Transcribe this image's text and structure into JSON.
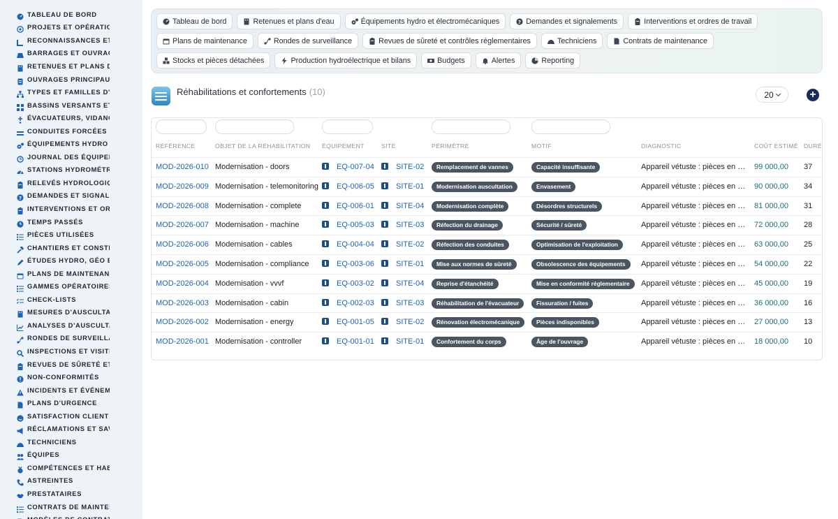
{
  "sidebar": {
    "items": [
      {
        "label": "Tableau de bord",
        "icon": "dashboard-icon"
      },
      {
        "label": "Projets et opérations",
        "icon": "target-icon"
      },
      {
        "label": "Reconnaissances et visites",
        "icon": "ruler-icon"
      },
      {
        "label": "Barrages et ouvrages",
        "icon": "dam-icon"
      },
      {
        "label": "Retenues et plans d'eau",
        "icon": "building-icon"
      },
      {
        "label": "Ouvrages principaux",
        "icon": "document-icon"
      },
      {
        "label": "Types et familles d'ouvrages",
        "icon": "sitemap-icon"
      },
      {
        "label": "Bassins versants et affluents",
        "icon": "grid-icon"
      },
      {
        "label": "Évacuateurs, vidanges",
        "icon": "faucet-icon"
      },
      {
        "label": "Conduites forcées et galeries",
        "icon": "pipe-icon"
      },
      {
        "label": "Équipements hydro et électromécaniques",
        "icon": "cogs-icon"
      },
      {
        "label": "Journal des équipements",
        "icon": "history-icon"
      },
      {
        "label": "Stations hydrométriques",
        "icon": "gauge-icon"
      },
      {
        "label": "Relevés hydrologiques",
        "icon": "clipboard-icon"
      },
      {
        "label": "Demandes et signalements",
        "icon": "question-icon"
      },
      {
        "label": "Interventions et ordres de travail",
        "icon": "clipboard-icon"
      },
      {
        "label": "Temps passés",
        "icon": "clock-icon"
      },
      {
        "label": "Pièces utilisées",
        "icon": "list-icon"
      },
      {
        "label": "Chantiers et constructions",
        "icon": "hammer-icon"
      },
      {
        "label": "Études hydro, géo et structure",
        "icon": "pencil-icon"
      },
      {
        "label": "Plans de maintenance",
        "icon": "calendar-icon"
      },
      {
        "label": "Gammes opératoires",
        "icon": "list-icon"
      },
      {
        "label": "Check-lists",
        "icon": "checklist-icon"
      },
      {
        "label": "Mesures d'auscultation",
        "icon": "building-icon"
      },
      {
        "label": "Analyses d'auscultation",
        "icon": "chart-icon"
      },
      {
        "label": "Rondes de surveillance",
        "icon": "route-icon"
      },
      {
        "label": "Inspections et visites",
        "icon": "search-icon"
      },
      {
        "label": "Revues de sûreté et contrôles",
        "icon": "clipboard-icon"
      },
      {
        "label": "Non-conformités",
        "icon": "alert-icon"
      },
      {
        "label": "Incidents et événements",
        "icon": "warning-icon"
      },
      {
        "label": "Plans d'urgence",
        "icon": "file-icon"
      },
      {
        "label": "Satisfaction client",
        "icon": "smile-icon"
      },
      {
        "label": "Réclamations et SAV",
        "icon": "megaphone-icon"
      },
      {
        "label": "Techniciens",
        "icon": "helmet-icon"
      },
      {
        "label": "Équipes",
        "icon": "users-icon"
      },
      {
        "label": "Compétences et habilitations",
        "icon": "medal-icon"
      },
      {
        "label": "Astreintes",
        "icon": "phone-icon"
      },
      {
        "label": "Prestataires",
        "icon": "handshake-icon"
      },
      {
        "label": "Contrats de maintenance",
        "icon": "list-icon"
      },
      {
        "label": "Modèles de contrats",
        "icon": "file-icon"
      }
    ]
  },
  "tabs": [
    {
      "label": "Tableau de bord",
      "icon": "dashboard-icon"
    },
    {
      "label": "Retenues et plans d'eau",
      "icon": "building-icon"
    },
    {
      "label": "Équipements hydro et électromécaniques",
      "icon": "cogs-icon"
    },
    {
      "label": "Demandes et signalements",
      "icon": "question-icon"
    },
    {
      "label": "Interventions et ordres de travail",
      "icon": "clipboard-icon"
    },
    {
      "label": "Plans de maintenance",
      "icon": "calendar-icon"
    },
    {
      "label": "Rondes de surveillance",
      "icon": "route-icon"
    },
    {
      "label": "Revues de sûreté et contrôles réglementaires",
      "icon": "clipboard-icon"
    },
    {
      "label": "Techniciens",
      "icon": "helmet-icon"
    },
    {
      "label": "Contrats de maintenance",
      "icon": "file-icon"
    },
    {
      "label": "Stocks et pièces détachées",
      "icon": "boxes-icon"
    },
    {
      "label": "Production hydroélectrique et bilans",
      "icon": "bolt-icon"
    },
    {
      "label": "Budgets",
      "icon": "money-icon"
    },
    {
      "label": "Alertes",
      "icon": "bell-icon"
    },
    {
      "label": "Reporting",
      "icon": "pie-icon"
    }
  ],
  "page": {
    "title": "Réhabilitations et confortements",
    "count": "(10)",
    "per_page": "20"
  },
  "columns": [
    "Référence",
    "Objet de la réhabilitation",
    "Équipement",
    "Site",
    "Périmètre",
    "Motif",
    "Diagnostic",
    "Coût estimé",
    "Durée"
  ],
  "rows": [
    {
      "ref": "MOD-2026-010",
      "objet": "Modernisation - doors",
      "equip": "EQ-007-04",
      "site": "SITE-02",
      "perimetre": "Remplacement de vannes",
      "motif": "Capacité insuffisante",
      "diag": "Appareil vétuste : pièces en obsolescence",
      "cout": "99 000,00",
      "duree": "37"
    },
    {
      "ref": "MOD-2026-009",
      "objet": "Modernisation - telemonitoring",
      "equip": "EQ-006-05",
      "site": "SITE-01",
      "perimetre": "Modernisation auscultation",
      "motif": "Envasement",
      "diag": "Appareil vétuste : pièces en obsolescence",
      "cout": "90 000,00",
      "duree": "34"
    },
    {
      "ref": "MOD-2026-008",
      "objet": "Modernisation - complete",
      "equip": "EQ-006-01",
      "site": "SITE-04",
      "perimetre": "Modernisation complète",
      "motif": "Désordres structurels",
      "diag": "Appareil vétuste : pièces en obsolescence",
      "cout": "81 000,00",
      "duree": "31"
    },
    {
      "ref": "MOD-2026-007",
      "objet": "Modernisation - machine",
      "equip": "EQ-005-03",
      "site": "SITE-03",
      "perimetre": "Réfection du drainage",
      "motif": "Sécurité / sûreté",
      "diag": "Appareil vétuste : pièces en obsolescence",
      "cout": "72 000,00",
      "duree": "28"
    },
    {
      "ref": "MOD-2026-006",
      "objet": "Modernisation - cables",
      "equip": "EQ-004-04",
      "site": "SITE-02",
      "perimetre": "Réfection des conduites",
      "motif": "Optimisation de l'exploitation",
      "diag": "Appareil vétuste : pièces en obsolescence",
      "cout": "63 000,00",
      "duree": "25"
    },
    {
      "ref": "MOD-2026-005",
      "objet": "Modernisation - compliance",
      "equip": "EQ-003-06",
      "site": "SITE-01",
      "perimetre": "Mise aux normes de sûreté",
      "motif": "Obsolescence des équipements",
      "diag": "Appareil vétuste : pièces en obsolescence",
      "cout": "54 000,00",
      "duree": "22"
    },
    {
      "ref": "MOD-2026-004",
      "objet": "Modernisation - vvvf",
      "equip": "EQ-003-02",
      "site": "SITE-04",
      "perimetre": "Reprise d'étanchéité",
      "motif": "Mise en conformité réglementaire",
      "diag": "Appareil vétuste : pièces en obsolescence",
      "cout": "45 000,00",
      "duree": "19"
    },
    {
      "ref": "MOD-2026-003",
      "objet": "Modernisation - cabin",
      "equip": "EQ-002-03",
      "site": "SITE-03",
      "perimetre": "Réhabilitation de l'évacuateur",
      "motif": "Fissuration / fuites",
      "diag": "Appareil vétuste : pièces en obsolescence",
      "cout": "36 000,00",
      "duree": "16"
    },
    {
      "ref": "MOD-2026-002",
      "objet": "Modernisation - energy",
      "equip": "EQ-001-05",
      "site": "SITE-02",
      "perimetre": "Rénovation électromécanique",
      "motif": "Pièces indisponibles",
      "diag": "Appareil vétuste : pièces en obsolescence",
      "cout": "27 000,00",
      "duree": "13"
    },
    {
      "ref": "MOD-2026-001",
      "objet": "Modernisation - controller",
      "equip": "EQ-001-01",
      "site": "SITE-01",
      "perimetre": "Confortement du corps",
      "motif": "Âge de l'ouvrage",
      "diag": "Appareil vétuste : pièces en obsolescence",
      "cout": "18 000,00",
      "duree": "10"
    }
  ],
  "colors": {
    "accent": "#1d64b6",
    "badge": "#4a5561",
    "cost": "#1a6d75",
    "sidebar_bg": "#eef3f7"
  }
}
